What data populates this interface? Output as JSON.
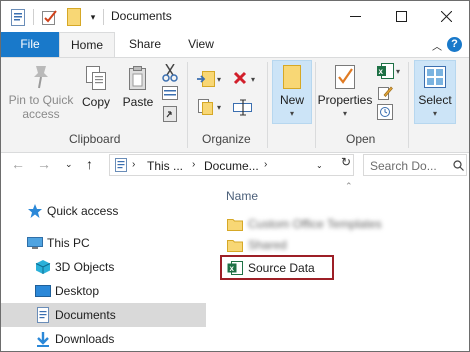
{
  "window": {
    "title": "Documents"
  },
  "tabs": {
    "file": "File",
    "home": "Home",
    "share": "Share",
    "view": "View"
  },
  "ribbon": {
    "clipboard": {
      "pin_label": "Pin to Quick access",
      "pin_line1": "Pin to Quick",
      "pin_line2": "access",
      "copy_label": "Copy",
      "paste_label": "Paste",
      "group_label": "Clipboard"
    },
    "organize": {
      "group_label": "Organize"
    },
    "new": {
      "new_label": "New"
    },
    "open": {
      "properties_label": "Properties",
      "group_label": "Open"
    },
    "select": {
      "select_label": "Select"
    }
  },
  "address": {
    "segment1": "This ...",
    "segment2": "Docume...",
    "search_placeholder": "Search Do..."
  },
  "navpane": {
    "items": [
      {
        "label": "Quick access",
        "icon": "star-icon"
      },
      {
        "label": "This PC",
        "icon": "monitor-icon"
      },
      {
        "label": "3D Objects",
        "icon": "cube-icon"
      },
      {
        "label": "Desktop",
        "icon": "desktop-icon"
      },
      {
        "label": "Documents",
        "icon": "document-icon",
        "selected": true
      },
      {
        "label": "Downloads",
        "icon": "download-icon"
      }
    ]
  },
  "content": {
    "column_name": "Name",
    "files": [
      {
        "name": "Custom Office Templates",
        "type": "folder",
        "blurred": true
      },
      {
        "name": "Shared",
        "type": "folder",
        "blurred": true
      },
      {
        "name": "Source Data",
        "type": "excel",
        "highlighted": true
      }
    ]
  },
  "colors": {
    "accent": "#1979ca",
    "highlight_border": "#9d1f26",
    "selected_bg": "#d9d9d9"
  }
}
